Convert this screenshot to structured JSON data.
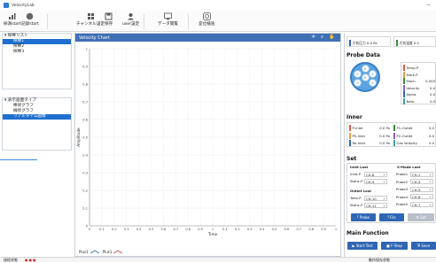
{
  "app": {
    "title": "VelocityLab"
  },
  "toolbar": {
    "measure_start": "探測start",
    "record_start": "記録start",
    "channel_settings": "チャンネル設定",
    "save": "保存",
    "user_settings": "user設定",
    "data_view": "データ閲覧",
    "transform_check": "変位検査"
  },
  "tree1": {
    "root": "探棒リスト",
    "items": [
      "探棒1",
      "探棒2",
      "探棒3"
    ]
  },
  "tree2": {
    "root": "表示画面タイプ",
    "items": [
      "棒状グラフ",
      "線状グラフ",
      "リアルタイム画像"
    ]
  },
  "chart": {
    "header": "Velocity Chart",
    "legend": [
      "Plus1",
      "Plus1"
    ]
  },
  "chart_data": {
    "type": "line",
    "title": "",
    "xlabel": "Time",
    "ylabel": "Amplitude",
    "xlim": [
      0,
      1
    ],
    "ylim": [
      0,
      1
    ],
    "x_ticks": [
      "0",
      "0.1",
      "0.2",
      "0.3",
      "0.4",
      "0.5",
      "0.6",
      "0.7",
      "0.8",
      "0.9",
      "1",
      "0.1",
      "0.2",
      "0.3",
      "0.4",
      "0.5",
      "0.6",
      "0.7",
      "0.8",
      "0.9",
      "1"
    ],
    "y_ticks": [
      "0",
      "0.1",
      "0.2",
      "0.3",
      "0.4",
      "0.5",
      "0.6",
      "0.7",
      "0.8",
      "0.9",
      "1"
    ],
    "series": []
  },
  "top_readouts": [
    {
      "label": "大気圧力",
      "value": "0.0",
      "unit": "Pa"
    },
    {
      "label": "大気温度",
      "value": "0.0",
      "unit": ""
    }
  ],
  "probe_data": {
    "title": "Probe Data",
    "dots": [
      "0",
      "0",
      "0",
      "0",
      "0",
      "0"
    ],
    "rows": [
      {
        "label": "Temp-P",
        "value": "",
        "color": "#e05a4a"
      },
      {
        "label": "Mark-P",
        "value": "",
        "color": "#e0a040"
      },
      {
        "label": "Mach",
        "value": "0.000",
        "color": "#3c8a3c"
      },
      {
        "label": "Velocity",
        "value": "0.0",
        "color": "#8c60c0"
      },
      {
        "label": "Alpha",
        "value": "0.0",
        "color": "#2f66b3"
      },
      {
        "label": "Beta",
        "value": "0.0",
        "color": "#3aa0a0"
      }
    ]
  },
  "inner": {
    "title": "Inner",
    "rows": [
      {
        "label": "P-Inlet",
        "value": "0.0",
        "unit": "Pa",
        "color": "#e05a4a"
      },
      {
        "label": "P1-Outlet",
        "value": "0.0",
        "unit": "",
        "color": "#3c8a3c"
      },
      {
        "label": "P0-Inlet",
        "value": "0.0",
        "unit": "Pa",
        "color": "#e0a040"
      },
      {
        "label": "P2-Outlet",
        "value": "0.0",
        "unit": "",
        "color": "#8c60c0"
      },
      {
        "label": "Re-Inlet",
        "value": "0.0",
        "unit": "Pa",
        "color": "#2f66b3"
      },
      {
        "label": "Gas Velocity",
        "value": "0.0",
        "unit": "",
        "color": "#3aa0a0"
      }
    ]
  },
  "set": {
    "title": "Set",
    "inlet_label": "Inlet Last",
    "outlet_label": "Outlet Last",
    "safe_label": "S-Mode Last",
    "inlet": [
      {
        "label": "Inlet-P",
        "value": "CH-8"
      },
      {
        "label": "Static-P",
        "value": "CH-9"
      }
    ],
    "outlet": [
      {
        "label": "Total-P",
        "value": "CH-10"
      },
      {
        "label": "Static-P",
        "value": "CH-11"
      }
    ],
    "right": [
      {
        "label": "Probe1",
        "value": "CH-1"
      },
      {
        "label": "Probe2",
        "value": "CH-4"
      },
      {
        "label": "Probe3",
        "value": "CH-5"
      },
      {
        "label": "Probe4",
        "value": "CH-6"
      },
      {
        "label": "Probe5",
        "value": "CH-7"
      }
    ],
    "btn_probe": "Probe",
    "btn_file": "File",
    "btn_settings": "Set"
  },
  "main_function": {
    "title": "Main Function",
    "start": "Start Test",
    "stop": "F-Stop",
    "save": "Save"
  },
  "status": {
    "left": "接続状態",
    "right": "動作保存状態"
  }
}
